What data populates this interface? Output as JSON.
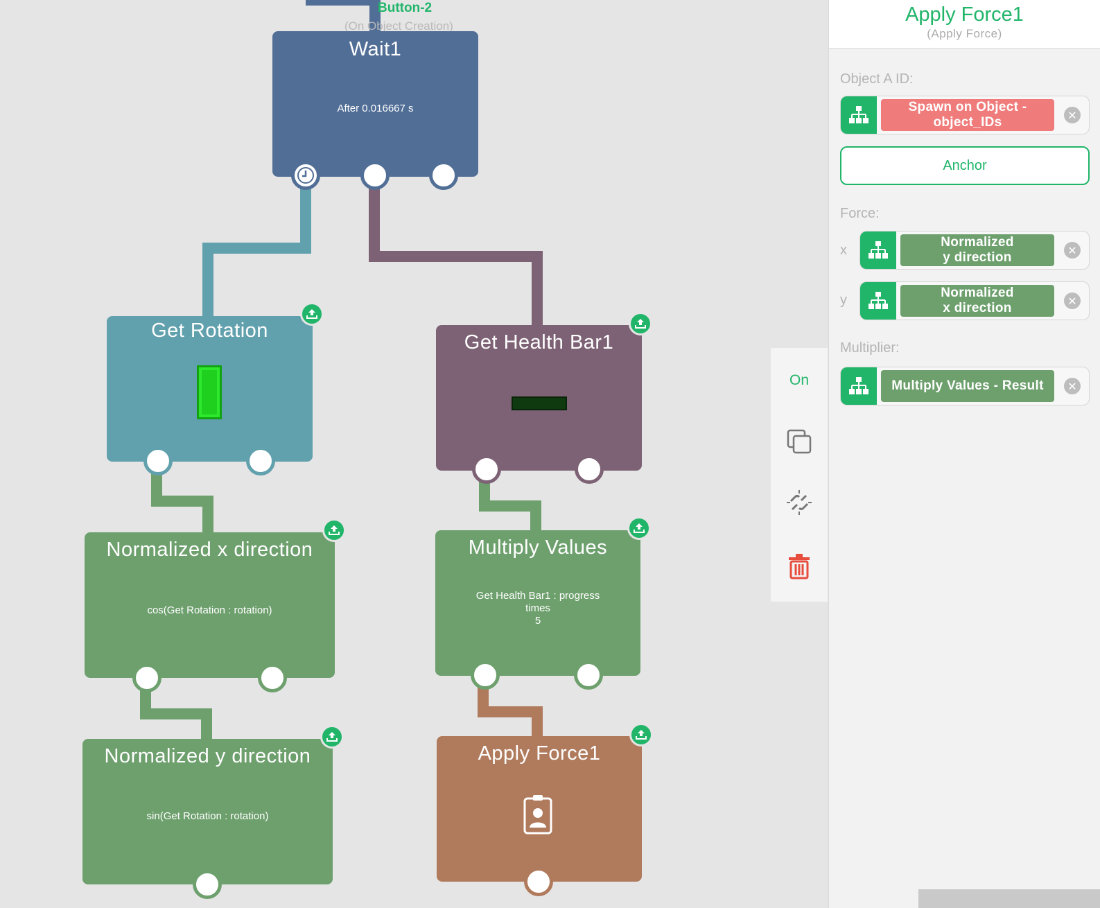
{
  "canvas": {
    "trigger": {
      "label": "Button-2",
      "sublabel": "(On Object Creation)"
    },
    "nodes": {
      "wait": {
        "title": "Wait1",
        "desc": "After 0.016667 s",
        "color": "#516e96"
      },
      "get_rotation": {
        "title": "Get Rotation",
        "color": "#61a0ad"
      },
      "get_health": {
        "title": "Get Health Bar1",
        "color": "#7d6275"
      },
      "norm_x": {
        "title": "Normalized x direction",
        "desc": "cos(Get Rotation : rotation)",
        "color": "#6ea06e"
      },
      "multiply": {
        "title": "Multiply Values",
        "desc_lines": [
          "Get Health Bar1 : progress",
          "times",
          "5"
        ],
        "color": "#6ea06e"
      },
      "norm_y": {
        "title": "Normalized y direction",
        "desc": "sin(Get Rotation : rotation)",
        "color": "#6ea06e"
      },
      "apply_force": {
        "title": "Apply Force1",
        "color": "#b07a5c"
      }
    }
  },
  "context_menu": {
    "toggle_label": "On",
    "icons": [
      "copy-icon",
      "unlink-icon",
      "trash-icon"
    ]
  },
  "panel": {
    "title": "Apply Force1",
    "subtitle": "(Apply Force)",
    "object_a": {
      "label": "Object A ID:",
      "value": "Spawn on Object - object_IDs",
      "value_lines": [
        "Spawn on Object -",
        "object_IDs"
      ],
      "chip_color": "#f07b7b"
    },
    "anchor_label": "Anchor",
    "force": {
      "label": "Force:",
      "x_label": "x",
      "x_lines": [
        "Normalized",
        "y direction"
      ],
      "y_label": "y",
      "y_lines": [
        "Normalized",
        "x direction"
      ]
    },
    "multiplier": {
      "label": "Multiplier:",
      "value": "Multiply Values - Result"
    }
  },
  "colors": {
    "accent": "#21b56a",
    "delete": "#e74c3c"
  }
}
